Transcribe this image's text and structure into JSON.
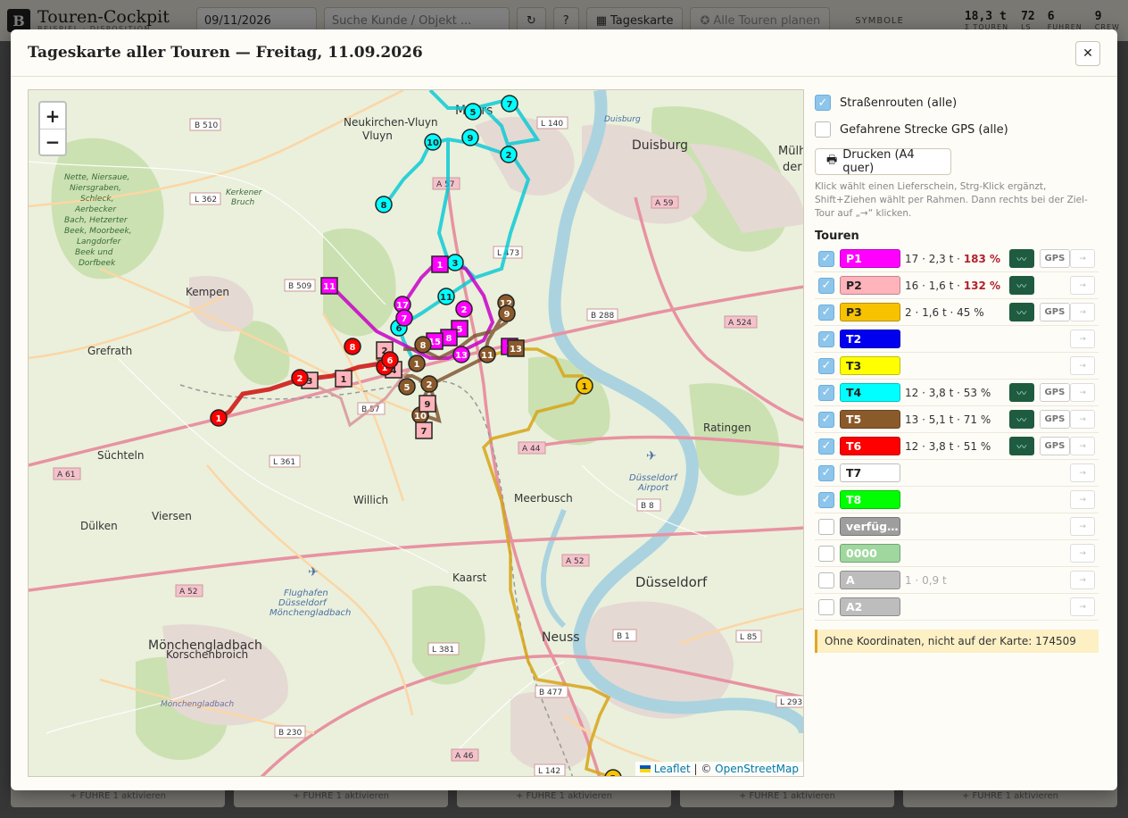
{
  "app": {
    "logo": "B",
    "title": "Touren-Cockpit",
    "subtitle": "BEISPIEL · DISPOSITION",
    "date_value": "09/11/2026",
    "search_placeholder": "Suche Kunde / Objekt ...",
    "refresh_label": "↻",
    "help_label": "?",
    "tageskarte_label": "Tageskarte",
    "plan_all_label": "Alle Touren planen",
    "symbole_label": "SYMBOLE",
    "stats": [
      {
        "value": "18,3 t",
        "label": "Σ TOUREN"
      },
      {
        "value": "72",
        "label": "LS"
      },
      {
        "value": "6",
        "label": "FUHREN"
      },
      {
        "value": "9",
        "label": "CREW"
      }
    ],
    "footer_buttons": [
      "+ FUHRE 1 aktivieren",
      "+ FUHRE 1 aktivieren",
      "+ FUHRE 1 aktivieren",
      "+ FUHRE 1 aktivieren",
      "+ FUHRE 1 aktivieren"
    ]
  },
  "modal": {
    "title": "Tageskarte aller Touren — Freitag, 11.09.2026",
    "close_label": "✕"
  },
  "map": {
    "zoom_in": "+",
    "zoom_out": "−",
    "attribution_leaflet": "Leaflet",
    "attribution_sep": " | © ",
    "attribution_osm": "OpenStreetMap",
    "cities": [
      "Neukirchen-Vluyn",
      "Moers",
      "Duisburg",
      "Kempen",
      "Grefrath",
      "Süchteln",
      "Willich",
      "Meerbusch",
      "Viersen",
      "Dülken",
      "Kaarst",
      "Düsseldorf",
      "Neuss",
      "Mönchengladbach",
      "Korschenbroich",
      "Ratingen",
      "Mülheim an der Ruhr",
      "Düsseldorf Airport",
      "Flughafen Düsseldorf Mönchengladbach",
      "Kerkener Bruch"
    ],
    "road_labels": [
      "B 510",
      "L 362",
      "B 509",
      "A 57",
      "L 473",
      "L 140",
      "A 59",
      "B 288",
      "A 524",
      "A 44",
      "B 8",
      "A 52",
      "L 361",
      "A 61",
      "L 381",
      "B 1",
      "L 85",
      "B 477",
      "B 230",
      "A 46",
      "L 142",
      "B 57",
      "L 293"
    ],
    "nature_label": "Nette, Niersaue, Niersgraben, Schleck, Aerbecker Bach, Hetzerter Beek, Moorbeek, Langdorfer Beek und Dorfbeek"
  },
  "panel": {
    "strassenrouten_label": "Straßenrouten (alle)",
    "strassenrouten_checked": true,
    "gps_label": "Gefahrene Strecke GPS (alle)",
    "gps_checked": false,
    "print_label": "Drucken (A4 quer)",
    "hint": "Klick wählt einen Lieferschein, Strg-Klick ergänzt, Shift+Ziehen wählt per Rahmen. Dann rechts bei der Ziel-Tour auf „→“ klicken.",
    "touren_heading": "Touren",
    "route_icon": "〰",
    "gps_button_label": "GPS",
    "arrow_label": "→",
    "tours": [
      {
        "name": "P1",
        "color": "#ff00ff",
        "text_color": "#ffffff",
        "checked": true,
        "info": "17 · 2,3 t · ",
        "pct": "183 %",
        "pct_warn": true,
        "route": true,
        "gps": true
      },
      {
        "name": "P2",
        "color": "#ffb3ba",
        "text_color": "#222222",
        "checked": true,
        "info": "16 · 1,6 t · ",
        "pct": "132 %",
        "pct_warn": true,
        "route": true,
        "gps": false
      },
      {
        "name": "P3",
        "color": "#f7c200",
        "text_color": "#222222",
        "checked": true,
        "info": "2 · 1,6 t · 45 %",
        "pct": "",
        "pct_warn": false,
        "route": true,
        "gps": true
      },
      {
        "name": "T2",
        "color": "#0000ee",
        "text_color": "#ffffff",
        "checked": true,
        "info": "",
        "pct": "",
        "pct_warn": false,
        "route": false,
        "gps": false
      },
      {
        "name": "T3",
        "color": "#ffff00",
        "text_color": "#222222",
        "checked": true,
        "info": "",
        "pct": "",
        "pct_warn": false,
        "route": false,
        "gps": false
      },
      {
        "name": "T4",
        "color": "#00ffff",
        "text_color": "#222222",
        "checked": true,
        "info": "12 · 3,8 t · 53 %",
        "pct": "",
        "pct_warn": false,
        "route": true,
        "gps": true
      },
      {
        "name": "T5",
        "color": "#8b5a2b",
        "text_color": "#ffffff",
        "checked": true,
        "info": "13 · 5,1 t · 71 %",
        "pct": "",
        "pct_warn": false,
        "route": true,
        "gps": true
      },
      {
        "name": "T6",
        "color": "#ff0000",
        "text_color": "#ffffff",
        "checked": true,
        "info": "12 · 3,8 t · 51 %",
        "pct": "",
        "pct_warn": false,
        "route": true,
        "gps": true
      },
      {
        "name": "T7",
        "color": "#ffffff",
        "text_color": "#222222",
        "checked": true,
        "info": "",
        "pct": "",
        "pct_warn": false,
        "route": false,
        "gps": false
      },
      {
        "name": "T8",
        "color": "#00ff00",
        "text_color": "#ffffff",
        "checked": true,
        "info": "",
        "pct": "",
        "pct_warn": false,
        "route": false,
        "gps": false
      },
      {
        "name": "verfüg…",
        "color": "#9e9e9e",
        "text_color": "#ffffff",
        "checked": false,
        "info": "",
        "pct": "",
        "pct_warn": false,
        "route": false,
        "gps": false
      },
      {
        "name": "0000",
        "color": "#9fd79f",
        "text_color": "#ffffff",
        "checked": false,
        "info": "",
        "pct": "",
        "pct_warn": false,
        "route": false,
        "gps": false
      },
      {
        "name": "A",
        "color": "#bdbdbd",
        "text_color": "#ffffff",
        "checked": false,
        "info": "1 · 0,9 t",
        "pct": "",
        "pct_warn": false,
        "faded": true,
        "route": false,
        "gps": false
      },
      {
        "name": "A2",
        "color": "#bdbdbd",
        "text_color": "#ffffff",
        "checked": false,
        "info": "",
        "pct": "",
        "pct_warn": false,
        "route": false,
        "gps": false
      }
    ],
    "warning": "Ohne Koordinaten, nicht auf der Karte: 174509"
  }
}
